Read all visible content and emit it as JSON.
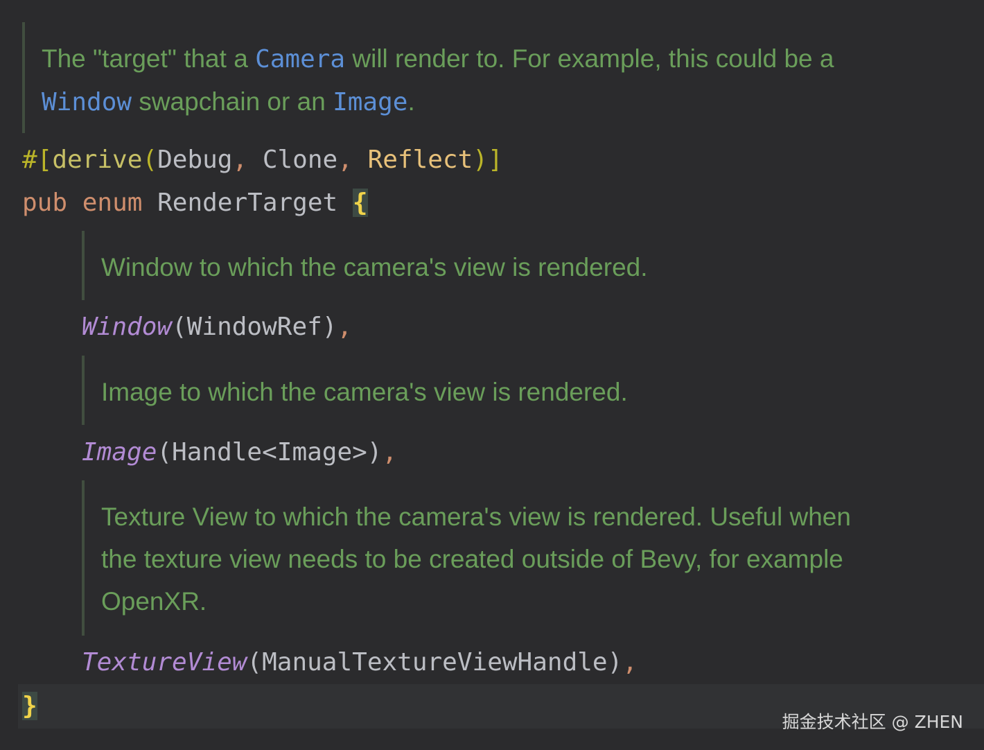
{
  "doc_comments": {
    "render_target": {
      "line1_before": "The \"target\" that a ",
      "line1_ref": "Camera",
      "line1_after": " will render to. For example, this could be a",
      "line2_ref1": "Window",
      "line2_mid": " swapchain or an ",
      "line2_ref2": "Image",
      "line2_end": "."
    },
    "window_variant": "Window to which the camera's view is rendered.",
    "image_variant": "Image to which the camera's view is rendered.",
    "texture_view_variant": {
      "line1": "Texture View to which the camera's view is rendered. Useful when",
      "line2": "the texture view needs to be created outside of Bevy, for example",
      "line3": "OpenXR."
    }
  },
  "code": {
    "attr_prefix": "#[",
    "attr_name": "derive",
    "attr_open": "(",
    "derive_1": "Debug",
    "derive_sep1": ", ",
    "derive_2": "Clone",
    "derive_sep2": ", ",
    "derive_3": "Reflect",
    "attr_close": ")]",
    "kw_pub": "pub",
    "kw_enum": "enum",
    "enum_name": "RenderTarget",
    "open_brace": "{",
    "close_brace": "}",
    "variant_window": "Window",
    "variant_window_arg": "(WindowRef)",
    "variant_image": "Image",
    "variant_image_arg": "(Handle<Image>)",
    "variant_texture": "TextureView",
    "variant_texture_arg": "(ManualTextureViewHandle)",
    "comma": ","
  },
  "watermark": "掘金技术社区 @ ZHEN",
  "colors": {
    "background": "#2b2b2d",
    "doc_comment": "#6a9e5a",
    "doc_link": "#5c8fd6",
    "keyword": "#cf8e6d",
    "variant": "#b28bd4",
    "brace": "#f0d34a"
  }
}
